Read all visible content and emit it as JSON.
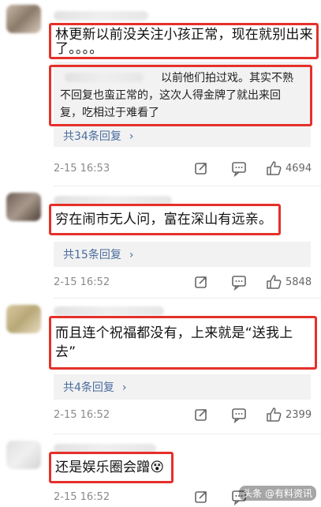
{
  "comments": [
    {
      "text_lines": [
        "林更新以前没关注小孩正常，现在就别出来",
        "了。。。。"
      ],
      "reply_preview_lines": [
        "以前他们拍过戏。其实不熟",
        "不回复也蛮正常的，这次人得金牌了就出来回",
        "复，吃相过于难看了"
      ],
      "reply_count": "共34条回复",
      "date": "2-15  16:53",
      "likes": "4694"
    },
    {
      "text_lines": [
        "穷在闹市无人问，富在深山有远亲。"
      ],
      "reply_count": "共15条回复",
      "date": "2-15  16:52",
      "likes": "5848"
    },
    {
      "text_lines": [
        "而且连个祝福都没有，上来就是“送我上",
        "去”"
      ],
      "reply_count": "共4条回复",
      "date": "2-15  16:52",
      "likes": "2399"
    },
    {
      "text_lines": [
        "还是娱乐圈会蹭😵"
      ],
      "date": "2-15  16:52"
    }
  ],
  "icons": {
    "chevron": "›",
    "share": "share-icon",
    "comment": "comment-icon",
    "like": "thumbs-up-icon"
  },
  "watermark": "头条 @有料资讯",
  "colors": {
    "highlight": "#e5302a",
    "reply_link": "#4a6c9d"
  }
}
